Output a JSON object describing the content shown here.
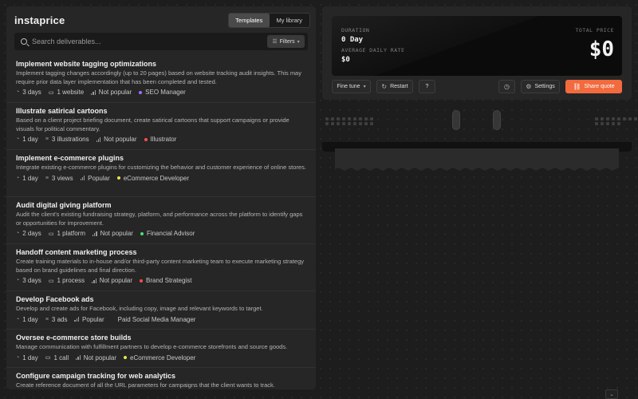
{
  "brand": "instaprice",
  "tabs": [
    "Templates",
    "My library"
  ],
  "search": {
    "placeholder": "Search deliverables..."
  },
  "filters_label": "Filters",
  "items": [
    {
      "title": "Implement website tagging optimizations",
      "desc": "Implement tagging changes accordingly (up to 20 pages) based on website tracking audit insights. This may require prior data layer implementation that has been completed and tested.",
      "duration": "3 days",
      "qty": "1 website",
      "popularity": "Not popular",
      "role": "SEO Manager",
      "role_color": "#a86bff"
    },
    {
      "title": "Illustrate satirical cartoons",
      "desc": "Based on a client project briefing document, create satirical cartoons that support campaigns or provide visuals for political commentary.",
      "duration": "1 day",
      "qty": "3 illustrations",
      "popularity": "Not popular",
      "role": "Illustrator",
      "role_color": "#ff4d4d"
    },
    {
      "title": "Implement e-commerce plugins",
      "desc": "Integrate existing e-commerce plugins for customizing the behavior and customer experience of online stores.",
      "duration": "1 day",
      "qty": "3 views",
      "popularity": "Popular",
      "role": "eCommerce Developer",
      "role_color": "#e6e64a"
    },
    {
      "title": "Audit digital giving platform",
      "desc": "Audit the client's existing fundraising strategy, platform, and performance across the platform to identify gaps or opportunities for improvement.",
      "duration": "2 days",
      "qty": "1 platform",
      "popularity": "Not popular",
      "role": "Financial Advisor",
      "role_color": "#4adf7a"
    },
    {
      "title": "Handoff content marketing process",
      "desc": "Create training materials to in-house and/or third-party content marketing team to execute marketing strategy based on brand guidelines and final direction.",
      "duration": "3 days",
      "qty": "1 process",
      "popularity": "Not popular",
      "role": "Brand Strategist",
      "role_color": "#ff4d4d"
    },
    {
      "title": "Develop Facebook ads",
      "desc": "Develop and create ads for Facebook, including copy, image and relevant keywords to target.",
      "duration": "1 day",
      "qty": "3 ads",
      "popularity": "Popular",
      "role": "Paid Social Media Manager",
      "role_color": "#262626"
    },
    {
      "title": "Oversee e-commerce store builds",
      "desc": "Manage communication with fulfillment partners to develop e-commerce storefronts and source goods.",
      "duration": "1 day",
      "qty": "1 call",
      "popularity": "Not popular",
      "role": "eCommerce Developer",
      "role_color": "#e6e64a"
    },
    {
      "title": "Configure campaign tracking for web analytics",
      "desc": "Create reference document of all the URL parameters for campaigns that the client wants to track.",
      "duration": "",
      "qty": "",
      "popularity": "",
      "role": "",
      "role_color": "#262626"
    }
  ],
  "quote": {
    "duration_label": "DURATION",
    "duration_value": "0 Day",
    "rate_label": "AVERAGE DAILY RATE",
    "rate_value": "$0",
    "total_label": "TOTAL PRICE",
    "total_value": "$0"
  },
  "controls": {
    "fine_tune": "Fine tune",
    "restart": "Restart",
    "help": "?",
    "settings": "Settings",
    "share": "Share quote"
  },
  "colors": {
    "accent": "#f26a3d",
    "panel": "#262626",
    "bg": "#1d1d1d"
  }
}
